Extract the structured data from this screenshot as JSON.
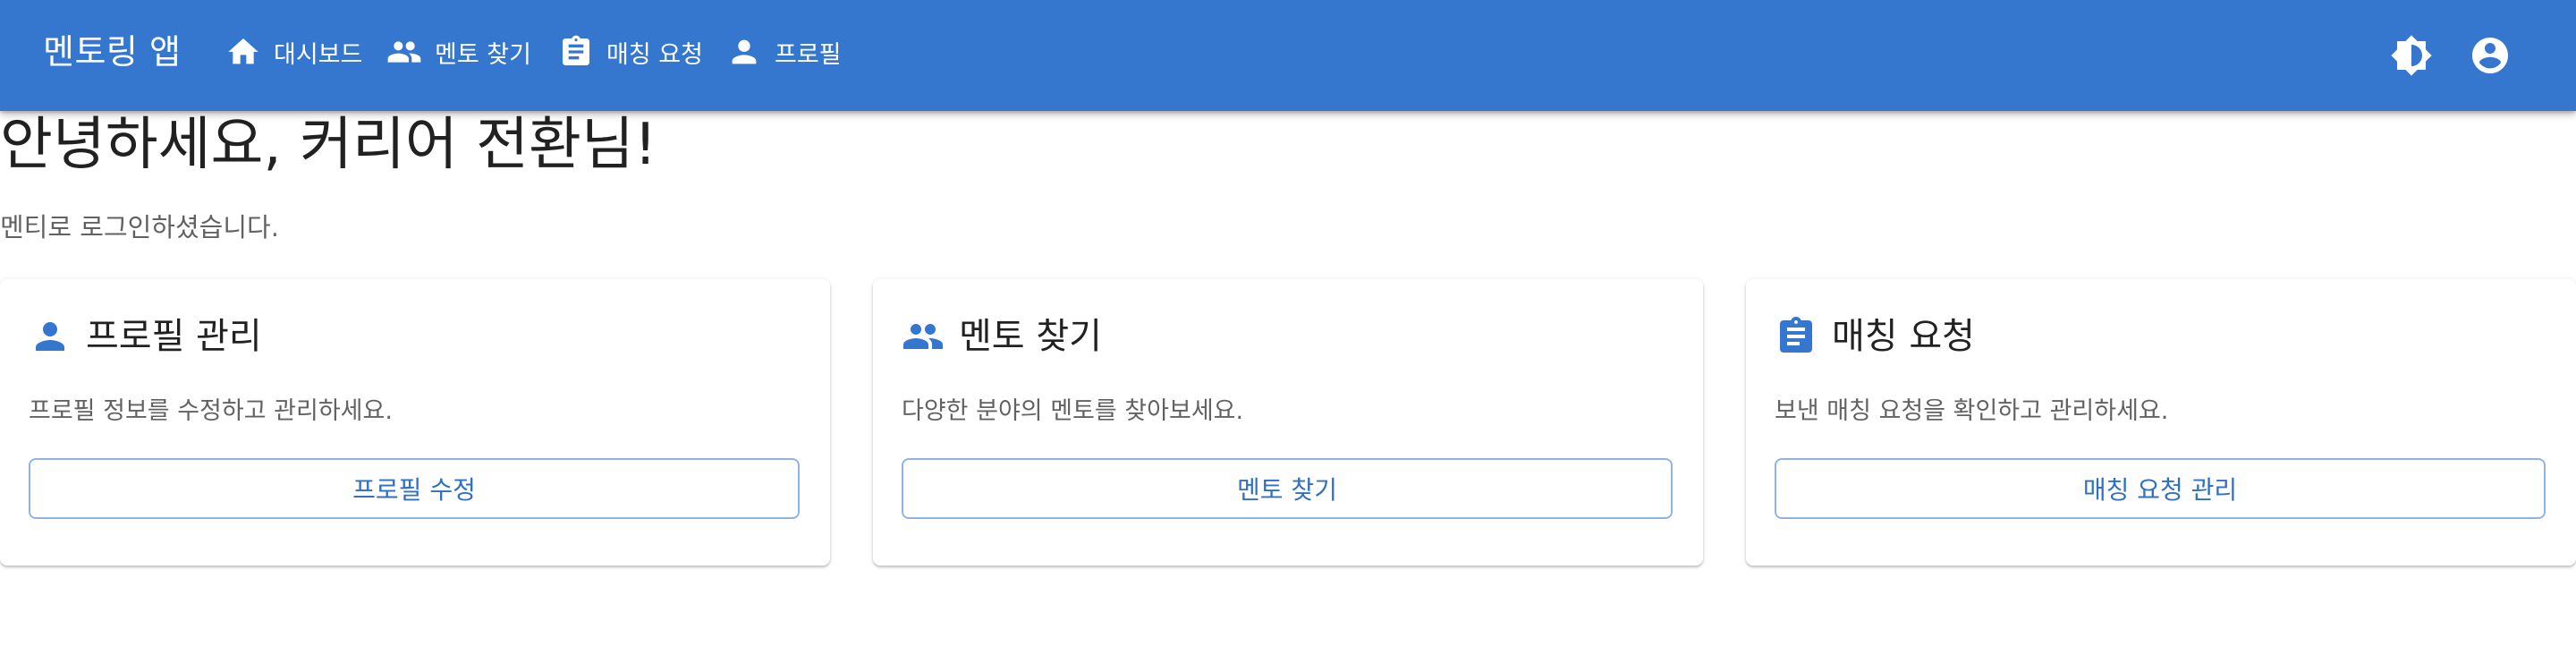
{
  "appbar": {
    "title": "멘토링 앱",
    "color": "#3577cf",
    "nav": [
      {
        "label": "대시보드",
        "icon": "home-icon"
      },
      {
        "label": "멘토 찾기",
        "icon": "people-icon"
      },
      {
        "label": "매칭 요청",
        "icon": "assignment-icon"
      },
      {
        "label": "프로필",
        "icon": "person-icon"
      }
    ],
    "actions": [
      {
        "icon": "brightness-icon"
      },
      {
        "icon": "account-circle-icon"
      }
    ]
  },
  "main": {
    "title": "안녕하세요, 커리어 전환님!",
    "subtitle": "멘티로 로그인하셨습니다.",
    "cards": [
      {
        "title": "프로필 관리",
        "icon": "person-icon",
        "description": "프로필 정보를 수정하고 관리하세요.",
        "button": "프로필 수정"
      },
      {
        "title": "멘토 찾기",
        "icon": "people-icon",
        "description": "다양한 분야의 멘토를 찾아보세요.",
        "button": "멘토 찾기"
      },
      {
        "title": "매칭 요청",
        "icon": "assignment-icon",
        "description": "보낸 매칭 요청을 확인하고 관리하세요.",
        "button": "매칭 요청 관리"
      }
    ]
  }
}
